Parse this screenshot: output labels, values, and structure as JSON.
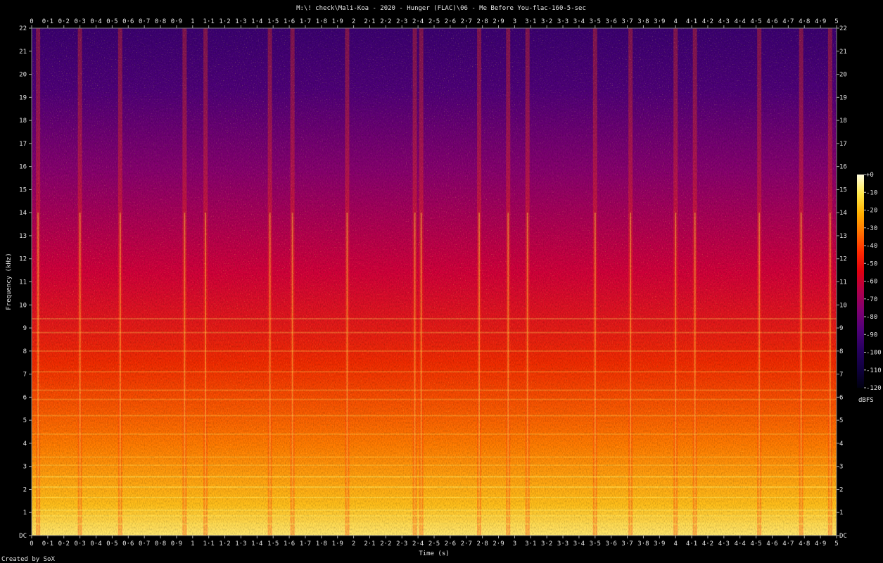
{
  "window": {
    "title": "M:\\! check\\Mali-Koa - 2020 - Hunger (FLAC)\\06 - Me Before You-flac-160-5-sec",
    "footer": "Created by SoX"
  },
  "chart_data": {
    "type": "heatmap",
    "kind": "spectrogram",
    "title": "M:\\! check\\Mali-Koa - 2020 - Hunger (FLAC)\\06 - Me Before You-flac-160-5-sec",
    "xlabel": "Time (s)",
    "ylabel": "Frequency (kHz)",
    "xlim": [
      0,
      5
    ],
    "ylim": [
      0,
      22
    ],
    "x_ticks": [
      "0",
      "0·1",
      "0·2",
      "0·3",
      "0·4",
      "0·5",
      "0·6",
      "0·7",
      "0·8",
      "0·9",
      "1",
      "1·1",
      "1·2",
      "1·3",
      "1·4",
      "1·5",
      "1·6",
      "1·7",
      "1·8",
      "1·9",
      "2",
      "2·1",
      "2·2",
      "2·3",
      "2·4",
      "2·5",
      "2·6",
      "2·7",
      "2·8",
      "2·9",
      "3",
      "3·1",
      "3·2",
      "3·3",
      "3·4",
      "3·5",
      "3·6",
      "3·7",
      "3·8",
      "3·9",
      "4",
      "4·1",
      "4·2",
      "4·3",
      "4·4",
      "4·5",
      "4·6",
      "4·7",
      "4·8",
      "4·9",
      "5"
    ],
    "y_ticks": [
      "DC",
      "1",
      "2",
      "3",
      "4",
      "5",
      "6",
      "7",
      "8",
      "9",
      "10",
      "11",
      "12",
      "13",
      "14",
      "15",
      "16",
      "17",
      "18",
      "19",
      "20",
      "21",
      "22"
    ],
    "colorbar": {
      "label": "dBFS",
      "range": [
        -120,
        0
      ],
      "ticks": [
        "+0",
        "-10",
        "-20",
        "-30",
        "-40",
        "-50",
        "-60",
        "-70",
        "-80",
        "-90",
        "-100",
        "-110",
        "-120"
      ],
      "colors": [
        "#fffde0",
        "#ffe84a",
        "#ffb000",
        "#ff7000",
        "#ff2a00",
        "#e00010",
        "#b0004a",
        "#800070",
        "#500078",
        "#280060",
        "#100040",
        "#000010"
      ]
    },
    "transients_s": [
      0.04,
      0.3,
      0.55,
      0.95,
      1.08,
      1.48,
      1.62,
      1.96,
      2.38,
      2.42,
      2.78,
      2.96,
      3.08,
      3.5,
      3.72,
      4.0,
      4.12,
      4.52,
      4.78,
      4.96
    ],
    "tonal_lines_khz": [
      0.5,
      0.85,
      1.1,
      1.65,
      2.1,
      2.55,
      3.05,
      3.4,
      4.4,
      5.2,
      5.9,
      6.3,
      7.1,
      8.0,
      8.8,
      9.4
    ],
    "grid": false
  }
}
